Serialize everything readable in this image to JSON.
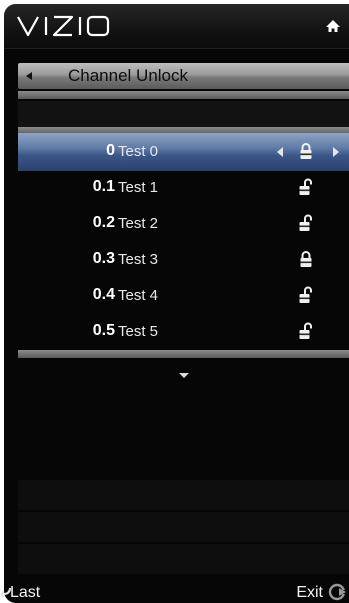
{
  "header": {
    "brand": "VIZIO",
    "home_icon": "home-icon"
  },
  "menu": {
    "title": "Channel Unlock",
    "back_icon": "left-arrow-icon"
  },
  "channels": [
    {
      "number": "0",
      "name": "Test 0",
      "lock": "locked",
      "selected": true
    },
    {
      "number": "0.1",
      "name": "Test 1",
      "lock": "unlocked",
      "selected": false
    },
    {
      "number": "0.2",
      "name": "Test 2",
      "lock": "unlocked",
      "selected": false
    },
    {
      "number": "0.3",
      "name": "Test 3",
      "lock": "locked",
      "selected": false
    },
    {
      "number": "0.4",
      "name": "Test 4",
      "lock": "unlocked",
      "selected": false
    },
    {
      "number": "0.5",
      "name": "Test 5",
      "lock": "unlocked",
      "selected": false
    }
  ],
  "footer": {
    "last_label": "Last",
    "exit_label": "Exit"
  },
  "colors": {
    "selection": "#3a5688",
    "background": "#060606"
  }
}
